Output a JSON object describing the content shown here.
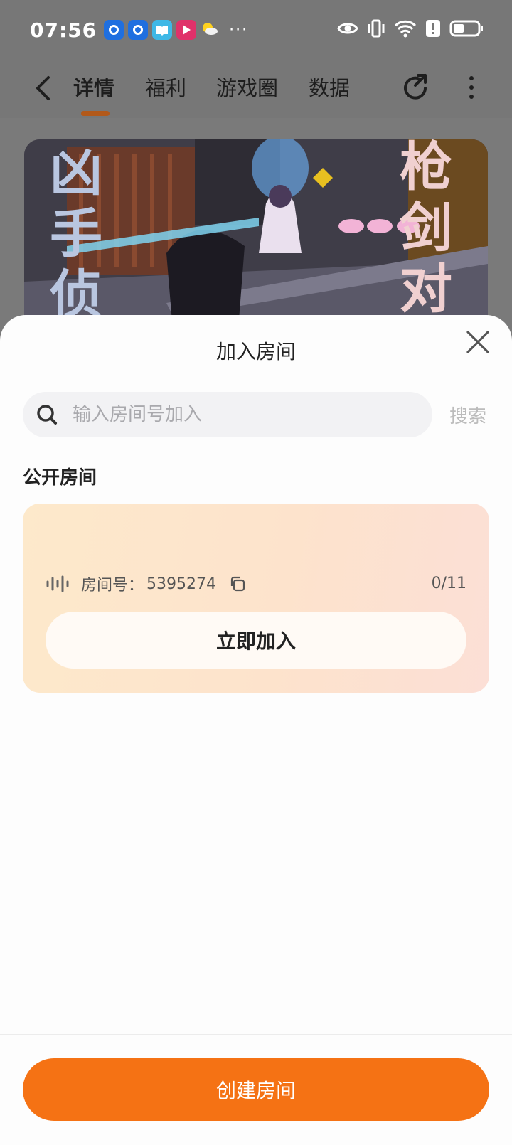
{
  "status_bar": {
    "time": "07:56",
    "more": "···",
    "app_icons": [
      {
        "name": "app-icon-1",
        "color": "#1f6fe0"
      },
      {
        "name": "app-icon-2",
        "color": "#1f6fe0"
      },
      {
        "name": "app-icon-3",
        "color": "#3fb8e6"
      },
      {
        "name": "app-icon-4",
        "color": "#e0316a"
      }
    ]
  },
  "nav": {
    "tabs": [
      {
        "label": "详情",
        "active": true
      },
      {
        "label": "福利",
        "active": false
      },
      {
        "label": "游戏圈",
        "active": false
      },
      {
        "label": "数据",
        "active": false
      }
    ]
  },
  "banner": {
    "left_words": [
      "凶",
      "手",
      "侦"
    ],
    "right_words": [
      "枪",
      "剑",
      "对"
    ]
  },
  "sheet": {
    "title": "加入房间",
    "search_placeholder": "输入房间号加入",
    "search_action": "搜索",
    "section_title": "公开房间",
    "room": {
      "label": "房间号：",
      "number": "5395274",
      "count": "0/11",
      "join_label": "立即加入"
    },
    "create_label": "创建房间"
  },
  "colors": {
    "accent": "#f57214",
    "tab_underline": "#b2591a"
  }
}
